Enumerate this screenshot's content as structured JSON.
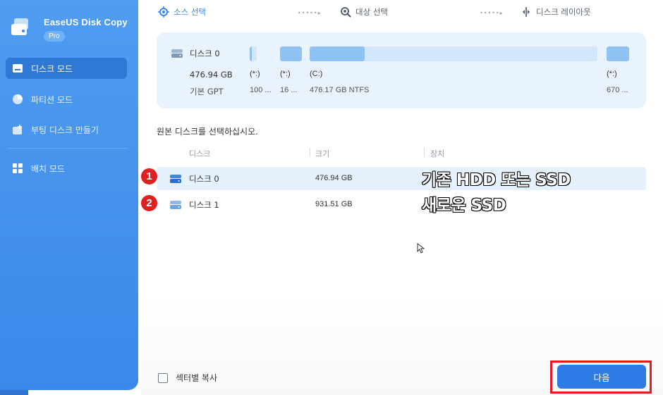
{
  "app": {
    "title": "EaseUS Disk Copy",
    "badge": "Pro"
  },
  "sidebar": {
    "items": [
      {
        "label": "디스크 모드",
        "icon": "disk-mode-icon",
        "active": true
      },
      {
        "label": "파티션 모드",
        "icon": "pie-icon",
        "active": false
      },
      {
        "label": "부팅 디스크 만들기",
        "icon": "boot-disk-icon",
        "active": false
      },
      {
        "label": "배치 모드",
        "icon": "grid-icon",
        "active": false
      }
    ]
  },
  "steps": [
    {
      "label": "소스 선택",
      "icon": "crosshair-icon",
      "active": true
    },
    {
      "label": "대상 선택",
      "icon": "target-search-icon",
      "active": false
    },
    {
      "label": "디스크 레이아웃",
      "icon": "layout-split-icon",
      "active": false
    }
  ],
  "step_separator": "•••••▸",
  "disk_card": {
    "name": "디스크 0",
    "size": "476.94 GB",
    "type": "기본 GPT",
    "partitions": [
      {
        "label": "(*:)",
        "desc": "100 ...",
        "usage": 0.3
      },
      {
        "label": "(*:)",
        "desc": "16 ...",
        "usage": 1.0
      },
      {
        "label": "(C:)",
        "desc": "476.17 GB NTFS",
        "usage": 0.19
      },
      {
        "label": "(*:)",
        "desc": "670 ...",
        "usage": 1.0
      }
    ]
  },
  "instruction": "원본 디스크를 선택하십시오.",
  "table": {
    "headers": [
      "디스크",
      "크기",
      "장치"
    ],
    "rows": [
      {
        "name": "디스크 0",
        "size": "476.94 GB",
        "selected": true
      },
      {
        "name": "디스크 1",
        "size": "931.51 GB",
        "selected": false
      }
    ]
  },
  "annotations": {
    "badges": [
      "1",
      "2"
    ],
    "labels": [
      "기존 HDD 또는 SSD",
      "새로운 SSD"
    ]
  },
  "footer": {
    "sector_copy_label": "섹터별 복사",
    "sector_copy_checked": false,
    "next_label": "다음"
  },
  "colors": {
    "accent": "#3b86e8",
    "sidebar": "#4a96ee",
    "highlight": "#e41b1b"
  }
}
